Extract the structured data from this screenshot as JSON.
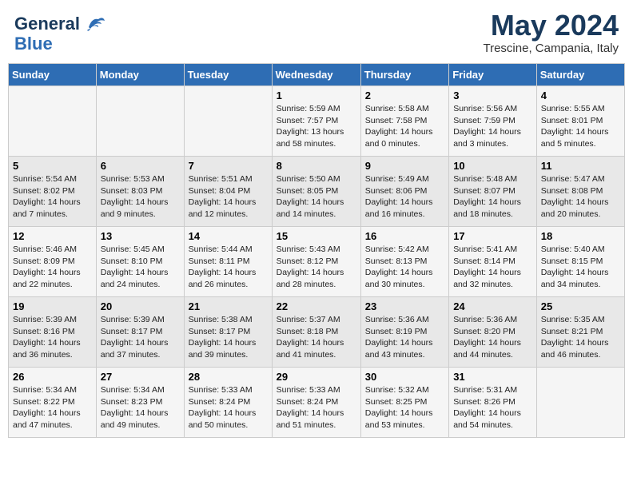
{
  "header": {
    "logo_line1": "General",
    "logo_line2": "Blue",
    "month": "May 2024",
    "location": "Trescine, Campania, Italy"
  },
  "weekdays": [
    "Sunday",
    "Monday",
    "Tuesday",
    "Wednesday",
    "Thursday",
    "Friday",
    "Saturday"
  ],
  "weeks": [
    [
      {
        "day": "",
        "info": ""
      },
      {
        "day": "",
        "info": ""
      },
      {
        "day": "",
        "info": ""
      },
      {
        "day": "1",
        "info": "Sunrise: 5:59 AM\nSunset: 7:57 PM\nDaylight: 13 hours\nand 58 minutes."
      },
      {
        "day": "2",
        "info": "Sunrise: 5:58 AM\nSunset: 7:58 PM\nDaylight: 14 hours\nand 0 minutes."
      },
      {
        "day": "3",
        "info": "Sunrise: 5:56 AM\nSunset: 7:59 PM\nDaylight: 14 hours\nand 3 minutes."
      },
      {
        "day": "4",
        "info": "Sunrise: 5:55 AM\nSunset: 8:01 PM\nDaylight: 14 hours\nand 5 minutes."
      }
    ],
    [
      {
        "day": "5",
        "info": "Sunrise: 5:54 AM\nSunset: 8:02 PM\nDaylight: 14 hours\nand 7 minutes."
      },
      {
        "day": "6",
        "info": "Sunrise: 5:53 AM\nSunset: 8:03 PM\nDaylight: 14 hours\nand 9 minutes."
      },
      {
        "day": "7",
        "info": "Sunrise: 5:51 AM\nSunset: 8:04 PM\nDaylight: 14 hours\nand 12 minutes."
      },
      {
        "day": "8",
        "info": "Sunrise: 5:50 AM\nSunset: 8:05 PM\nDaylight: 14 hours\nand 14 minutes."
      },
      {
        "day": "9",
        "info": "Sunrise: 5:49 AM\nSunset: 8:06 PM\nDaylight: 14 hours\nand 16 minutes."
      },
      {
        "day": "10",
        "info": "Sunrise: 5:48 AM\nSunset: 8:07 PM\nDaylight: 14 hours\nand 18 minutes."
      },
      {
        "day": "11",
        "info": "Sunrise: 5:47 AM\nSunset: 8:08 PM\nDaylight: 14 hours\nand 20 minutes."
      }
    ],
    [
      {
        "day": "12",
        "info": "Sunrise: 5:46 AM\nSunset: 8:09 PM\nDaylight: 14 hours\nand 22 minutes."
      },
      {
        "day": "13",
        "info": "Sunrise: 5:45 AM\nSunset: 8:10 PM\nDaylight: 14 hours\nand 24 minutes."
      },
      {
        "day": "14",
        "info": "Sunrise: 5:44 AM\nSunset: 8:11 PM\nDaylight: 14 hours\nand 26 minutes."
      },
      {
        "day": "15",
        "info": "Sunrise: 5:43 AM\nSunset: 8:12 PM\nDaylight: 14 hours\nand 28 minutes."
      },
      {
        "day": "16",
        "info": "Sunrise: 5:42 AM\nSunset: 8:13 PM\nDaylight: 14 hours\nand 30 minutes."
      },
      {
        "day": "17",
        "info": "Sunrise: 5:41 AM\nSunset: 8:14 PM\nDaylight: 14 hours\nand 32 minutes."
      },
      {
        "day": "18",
        "info": "Sunrise: 5:40 AM\nSunset: 8:15 PM\nDaylight: 14 hours\nand 34 minutes."
      }
    ],
    [
      {
        "day": "19",
        "info": "Sunrise: 5:39 AM\nSunset: 8:16 PM\nDaylight: 14 hours\nand 36 minutes."
      },
      {
        "day": "20",
        "info": "Sunrise: 5:39 AM\nSunset: 8:17 PM\nDaylight: 14 hours\nand 37 minutes."
      },
      {
        "day": "21",
        "info": "Sunrise: 5:38 AM\nSunset: 8:17 PM\nDaylight: 14 hours\nand 39 minutes."
      },
      {
        "day": "22",
        "info": "Sunrise: 5:37 AM\nSunset: 8:18 PM\nDaylight: 14 hours\nand 41 minutes."
      },
      {
        "day": "23",
        "info": "Sunrise: 5:36 AM\nSunset: 8:19 PM\nDaylight: 14 hours\nand 43 minutes."
      },
      {
        "day": "24",
        "info": "Sunrise: 5:36 AM\nSunset: 8:20 PM\nDaylight: 14 hours\nand 44 minutes."
      },
      {
        "day": "25",
        "info": "Sunrise: 5:35 AM\nSunset: 8:21 PM\nDaylight: 14 hours\nand 46 minutes."
      }
    ],
    [
      {
        "day": "26",
        "info": "Sunrise: 5:34 AM\nSunset: 8:22 PM\nDaylight: 14 hours\nand 47 minutes."
      },
      {
        "day": "27",
        "info": "Sunrise: 5:34 AM\nSunset: 8:23 PM\nDaylight: 14 hours\nand 49 minutes."
      },
      {
        "day": "28",
        "info": "Sunrise: 5:33 AM\nSunset: 8:24 PM\nDaylight: 14 hours\nand 50 minutes."
      },
      {
        "day": "29",
        "info": "Sunrise: 5:33 AM\nSunset: 8:24 PM\nDaylight: 14 hours\nand 51 minutes."
      },
      {
        "day": "30",
        "info": "Sunrise: 5:32 AM\nSunset: 8:25 PM\nDaylight: 14 hours\nand 53 minutes."
      },
      {
        "day": "31",
        "info": "Sunrise: 5:31 AM\nSunset: 8:26 PM\nDaylight: 14 hours\nand 54 minutes."
      },
      {
        "day": "",
        "info": ""
      }
    ]
  ]
}
